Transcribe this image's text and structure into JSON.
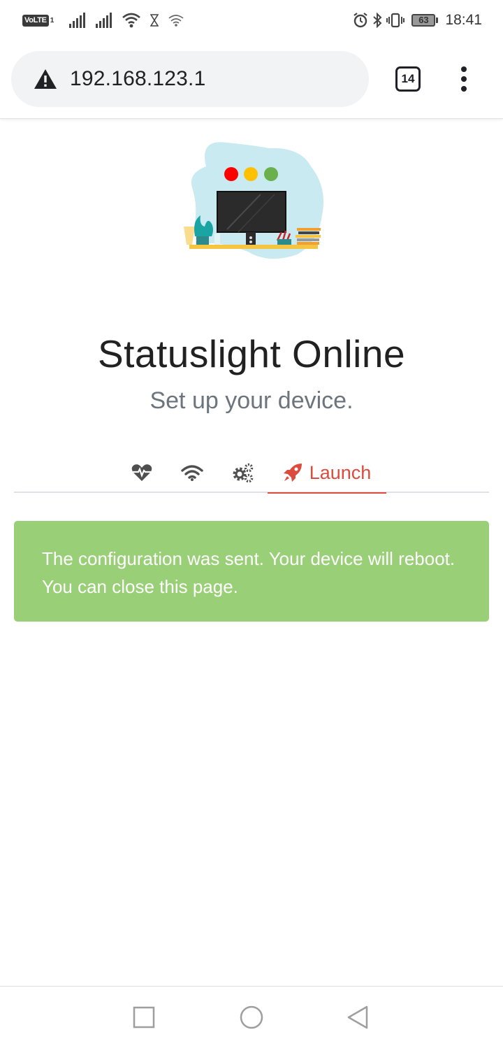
{
  "status_bar": {
    "volte_label": "VoLTE",
    "sim_number": "1",
    "battery_level": "63",
    "time": "18:41"
  },
  "browser": {
    "url": "192.168.123.1",
    "tab_count": "14"
  },
  "page": {
    "title": "Statuslight Online",
    "subtitle": "Set up your device.",
    "steps": {
      "active_label": "Launch"
    },
    "alert_message": "The configuration was sent. Your device will reboot. You can close this page."
  },
  "colors": {
    "accent": "#dc4c3e",
    "success": "#99cf76",
    "muted": "#6c757d"
  },
  "icons": {
    "health": "heartbeat-icon",
    "wifi": "wifi-icon",
    "settings": "cogs-icon",
    "launch": "rocket-icon"
  }
}
